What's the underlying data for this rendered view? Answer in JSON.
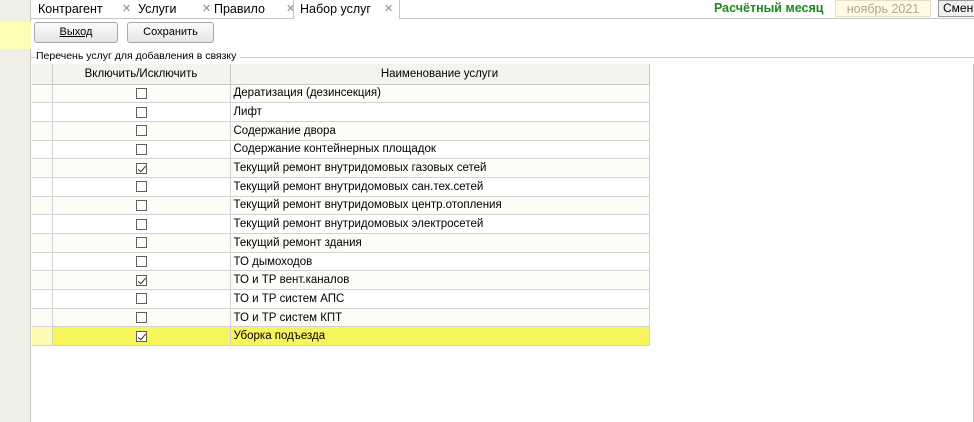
{
  "tabs": [
    {
      "label": "Контрагент",
      "closable": true
    },
    {
      "label": "Услуги",
      "closable": true
    },
    {
      "label": "Правило",
      "closable": true
    },
    {
      "label": "Набор услуг",
      "closable": true
    }
  ],
  "header": {
    "month_label": "Расчётный месяц",
    "month_value": "ноябрь 2021",
    "change_button": "Сменить"
  },
  "toolbar": {
    "exit_label": "Выход",
    "save_label": "Сохранить"
  },
  "section": {
    "title": "Перечень услуг для добавления в связку"
  },
  "table": {
    "columns": [
      "Включить/Исключить",
      "Наименование услуги"
    ],
    "rows": [
      {
        "name": "Дератизация (дезинсекция)",
        "checked": false
      },
      {
        "name": "Лифт",
        "checked": false
      },
      {
        "name": "Содержание двора",
        "checked": false
      },
      {
        "name": "Содержание контейнерных площадок",
        "checked": false
      },
      {
        "name": "Текущий ремонт внутридомовых газовых сетей",
        "checked": true
      },
      {
        "name": "Текущий ремонт внутридомовых сан.тех.сетей",
        "checked": false
      },
      {
        "name": "Текущий ремонт внутридомовых центр.отопления",
        "checked": false
      },
      {
        "name": "Текущий ремонт внутридомовых электросетей",
        "checked": false
      },
      {
        "name": "Текущий ремонт здания",
        "checked": false
      },
      {
        "name": "ТО дымоходов",
        "checked": false
      },
      {
        "name": "ТО и ТР вент.каналов",
        "checked": true
      },
      {
        "name": "ТО и ТР систем АПС",
        "checked": false
      },
      {
        "name": "ТО и ТР систем КПТ",
        "checked": false
      },
      {
        "name": "Уборка подъезда",
        "checked": true,
        "selected": true
      }
    ]
  },
  "colors": {
    "month_label": "#1d8a1d",
    "selected_row": "#f6f55b",
    "left_highlight": "#fdfdb4"
  }
}
